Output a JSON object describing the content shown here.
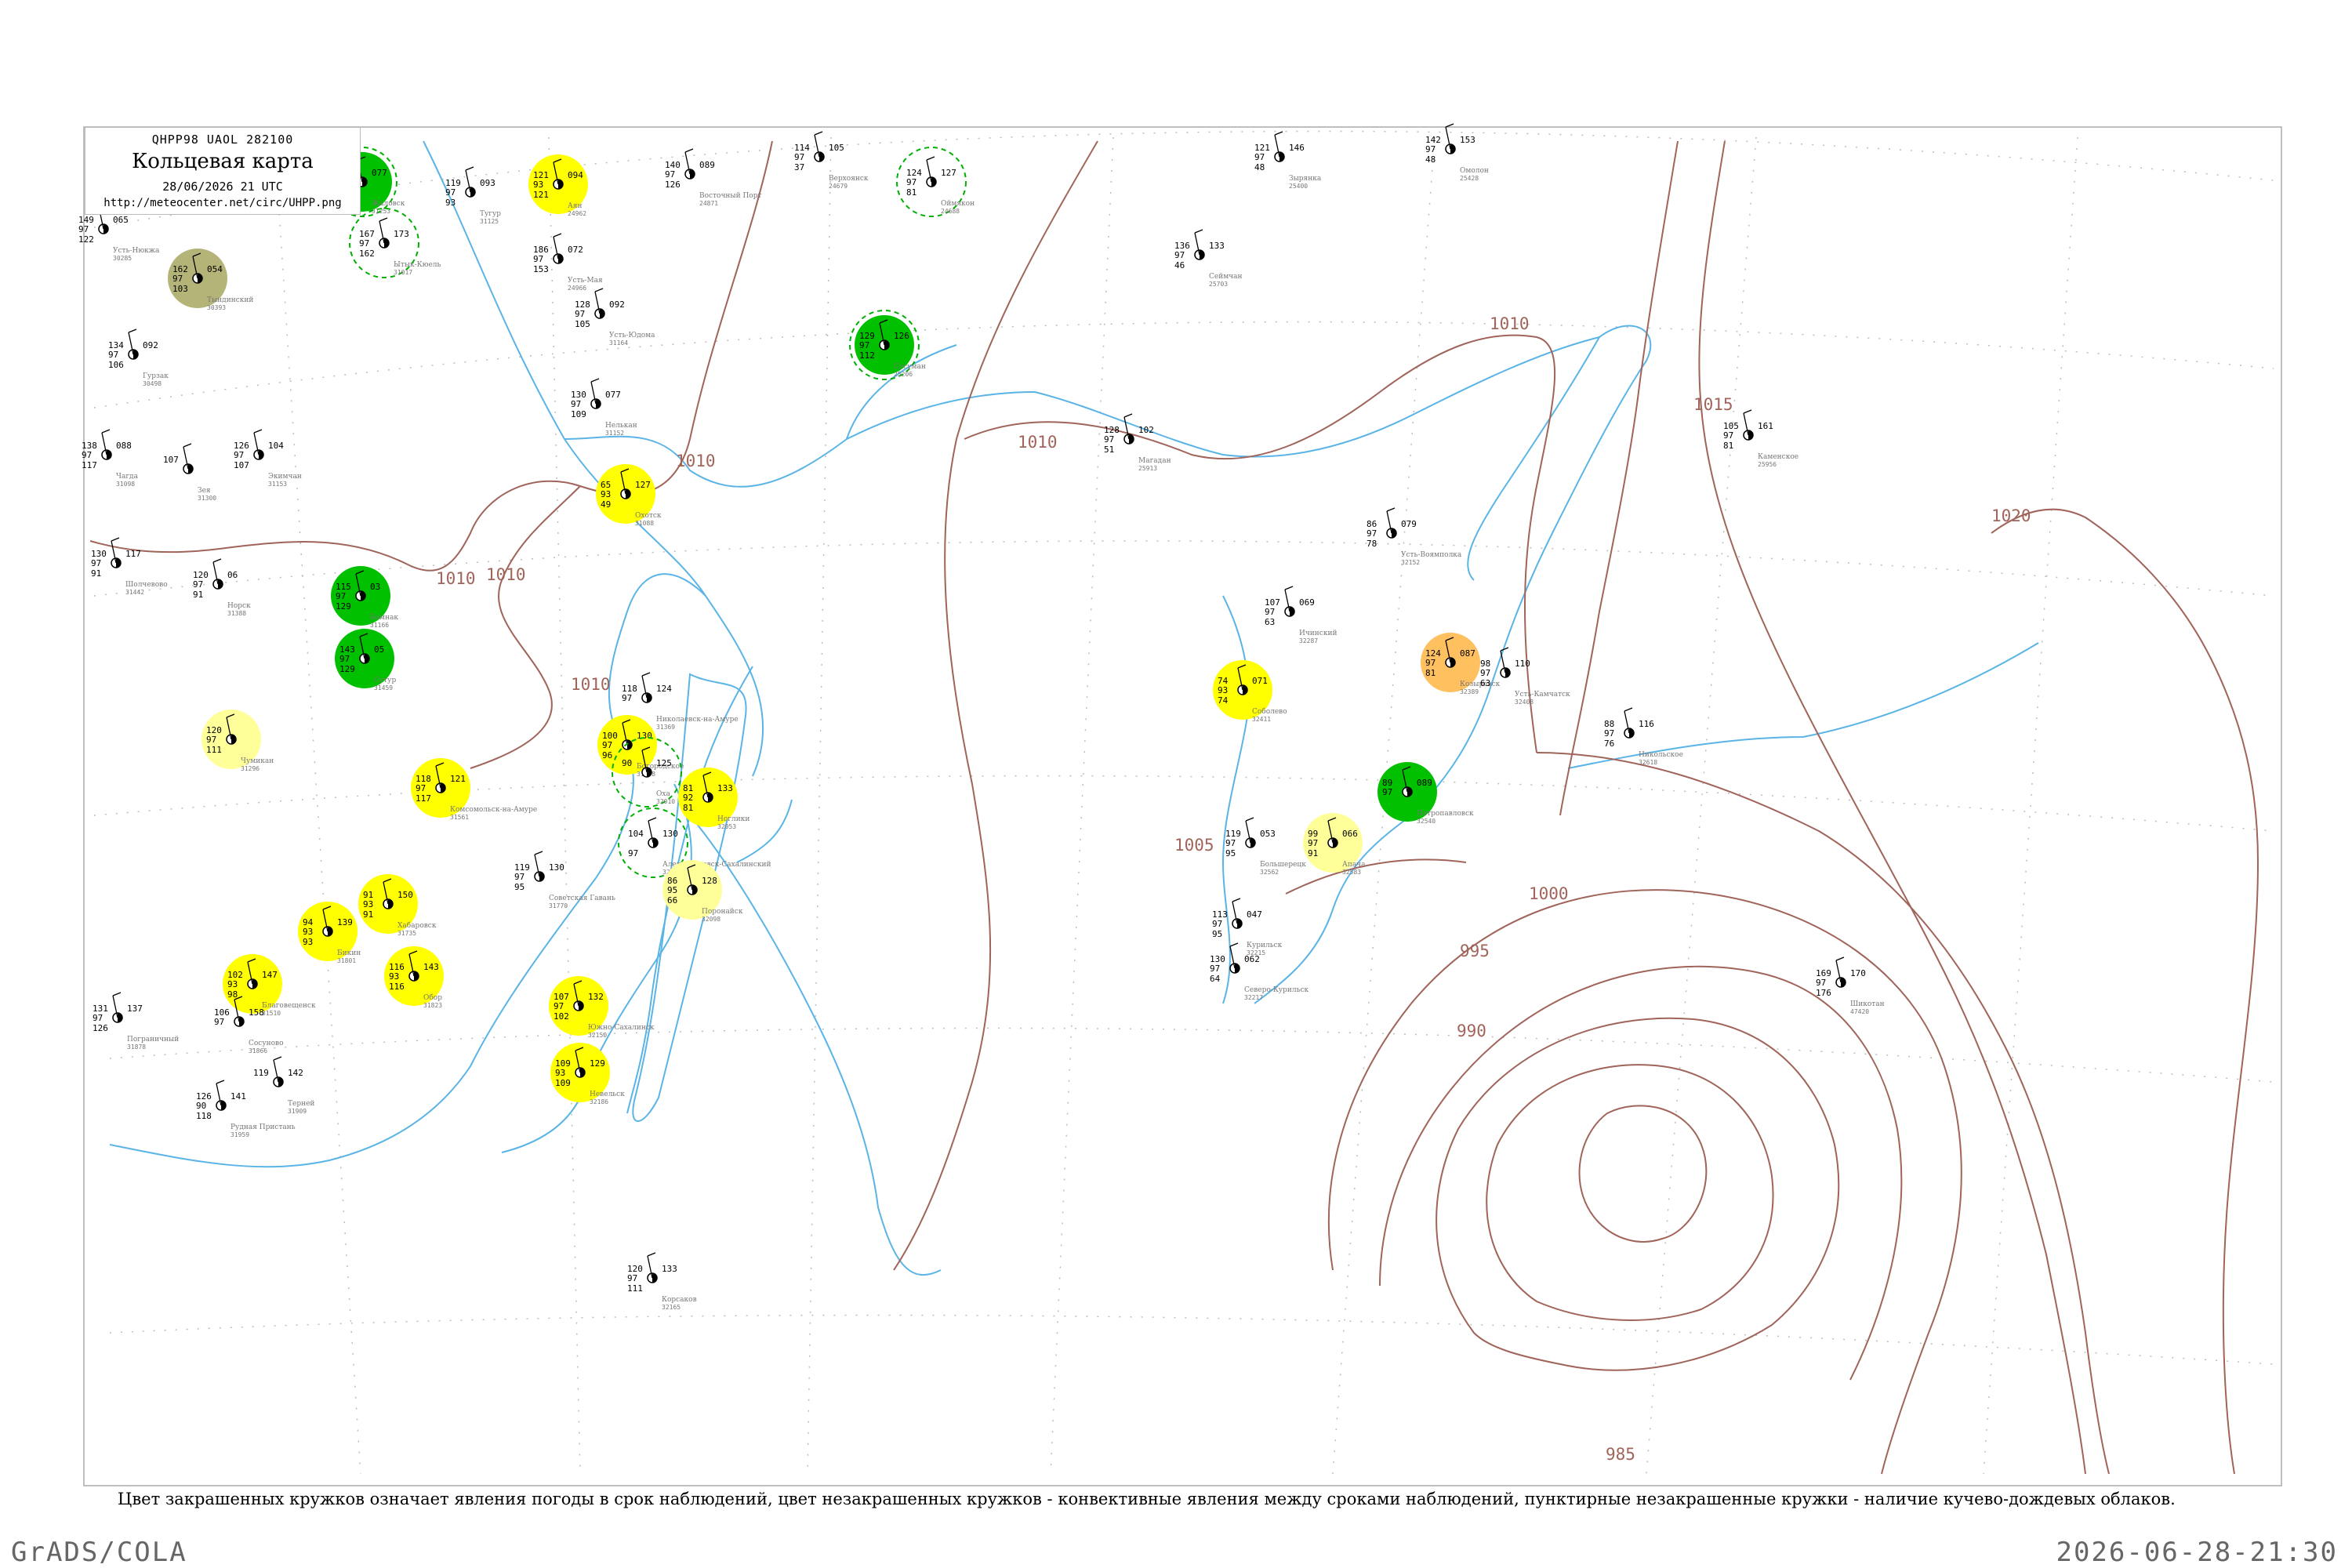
{
  "header": {
    "bulletin": "QHPP98  UAOL  282100",
    "title": "Кольцевая карта",
    "datetime": "28/06/2026 21 UTC",
    "url": "http://meteocenter.net/circ/UHPP.png"
  },
  "legend_note": "Цвет закрашенных кружков означает явления погоды в срок наблюдений, цвет незакрашенных кружков - конвективные явления между сроками наблюдений, пунктирные незакрашенные кружки - наличие кучево-дождевых облаков.",
  "footer": {
    "software": "GrADS/COLA",
    "timestamp": "2026-06-28-21:30"
  },
  "isobar_labels": [
    "1010",
    "1010",
    "1010",
    "1010",
    "1010",
    "1010",
    "1015",
    "1020",
    "1005",
    "1005",
    "1000",
    "995",
    "990",
    "985"
  ],
  "colors": {
    "isobar": "#a0645a",
    "coast": "#5ab4e6",
    "grid": "#bdbdbd",
    "yellow": "#ffff00",
    "light_yellow": "#ffff99",
    "green": "#00c000",
    "olive": "#b4b478",
    "orange": "#ffc060",
    "station": "#000000"
  },
  "stations": [
    {
      "name": "Усть-Нюкжа",
      "id": "30285",
      "temp": "149",
      "dew": "122",
      "p": "065",
      "mark": "97",
      "kind": "plain"
    },
    {
      "name": "Тындинский",
      "id": "30393",
      "temp": "162",
      "dew": "103",
      "p": "054",
      "mark": "97",
      "kind": "olive"
    },
    {
      "name": "Гурзак",
      "id": "30498",
      "temp": "134",
      "dew": "106",
      "p": "092",
      "mark": "97",
      "kind": "plain"
    },
    {
      "name": "Чагда",
      "id": "31098",
      "temp": "138",
      "dew": "117",
      "p": "088",
      "mark": "97",
      "kind": "plain"
    },
    {
      "name": "Зея",
      "id": "31300",
      "temp": "107",
      "dew": "",
      "p": "",
      "mark": "",
      "kind": "plain"
    },
    {
      "name": "Экимчан",
      "id": "31153",
      "temp": "126",
      "dew": "107",
      "p": "104",
      "mark": "97",
      "kind": "plain"
    },
    {
      "name": "Шолчевово",
      "id": "31442",
      "temp": "130",
      "dew": "91",
      "p": "117",
      "mark": "97",
      "kind": "plain"
    },
    {
      "name": "Норск",
      "id": "31388",
      "temp": "120",
      "dew": "91",
      "p": "06",
      "mark": "97",
      "kind": "plain"
    },
    {
      "name": "Бомнак",
      "id": "31166",
      "temp": "115",
      "dew": "129",
      "p": "03",
      "mark": "97",
      "kind": "green"
    },
    {
      "name": "Сутур",
      "id": "31459",
      "temp": "143",
      "dew": "129",
      "p": "05",
      "mark": "97",
      "kind": "green"
    },
    {
      "name": "Жаловск",
      "id": "31253",
      "temp": "158",
      "dew": "145",
      "p": "077",
      "mark": "97",
      "kind": "green_dash"
    },
    {
      "name": "Ытык-Кюель",
      "id": "31017",
      "temp": "167",
      "dew": "162",
      "p": "173",
      "mark": "97",
      "kind": "dash"
    },
    {
      "name": "Тугур",
      "id": "31125",
      "temp": "119",
      "dew": "93",
      "p": "093",
      "mark": "97",
      "kind": "plain"
    },
    {
      "name": "Аян",
      "id": "24962",
      "temp": "121",
      "dew": "121",
      "p": "094",
      "mark": "93",
      "kind": "yellow"
    },
    {
      "name": "Усть-Мая",
      "id": "24966",
      "temp": "186",
      "dew": "153",
      "p": "072",
      "mark": "97",
      "kind": "plain"
    },
    {
      "name": "Усть-Юдома",
      "id": "31164",
      "temp": "128",
      "dew": "105",
      "p": "092",
      "mark": "97",
      "kind": "plain"
    },
    {
      "name": "Нелькан",
      "id": "31152",
      "temp": "130",
      "dew": "109",
      "p": "077",
      "mark": "97",
      "kind": "plain"
    },
    {
      "name": "Охотск",
      "id": "31088",
      "temp": "65",
      "dew": "49",
      "p": "127",
      "mark": "93",
      "kind": "yellow"
    },
    {
      "name": "Восточный Порт",
      "id": "24871",
      "temp": "140",
      "dew": "126",
      "p": "089",
      "mark": "97",
      "kind": "plain"
    },
    {
      "name": "Верхоянск",
      "id": "24679",
      "temp": "114",
      "dew": "37",
      "p": "105",
      "mark": "97",
      "kind": "plain"
    },
    {
      "name": "Оймякон",
      "id": "24688",
      "temp": "124",
      "dew": "81",
      "p": "127",
      "mark": "97",
      "kind": "dash"
    },
    {
      "name": "Сусуман",
      "id": "25206",
      "temp": "129",
      "dew": "112",
      "p": "126",
      "mark": "97",
      "kind": "green_dash"
    },
    {
      "name": "Магадан",
      "id": "25913",
      "temp": "128",
      "dew": "51",
      "p": "102",
      "mark": "97",
      "kind": "plain"
    },
    {
      "name": "Зырянка",
      "id": "25400",
      "temp": "121",
      "dew": "48",
      "p": "146",
      "mark": "97",
      "kind": "plain"
    },
    {
      "name": "Сеймчан",
      "id": "25703",
      "temp": "136",
      "dew": "46",
      "p": "133",
      "mark": "97",
      "kind": "plain"
    },
    {
      "name": "Омолон",
      "id": "25428",
      "temp": "142",
      "dew": "48",
      "p": "153",
      "mark": "97",
      "kind": "plain"
    },
    {
      "name": "Каменское",
      "id": "25956",
      "temp": "105",
      "dew": "81",
      "p": "161",
      "mark": "97",
      "kind": "plain"
    },
    {
      "name": "Усть-Воямполка",
      "id": "32152",
      "temp": "86",
      "dew": "78",
      "p": "079",
      "mark": "97",
      "kind": "plain"
    },
    {
      "name": "Ичинский",
      "id": "32287",
      "temp": "107",
      "dew": "63",
      "p": "069",
      "mark": "97",
      "kind": "plain"
    },
    {
      "name": "Соболево",
      "id": "32411",
      "temp": "74",
      "dew": "74",
      "p": "071",
      "mark": "93",
      "kind": "yellow"
    },
    {
      "name": "Козыревск",
      "id": "32389",
      "temp": "124",
      "dew": "81",
      "p": "087",
      "mark": "97",
      "kind": "orange"
    },
    {
      "name": "Усть-Камчатск",
      "id": "32408",
      "temp": "98",
      "dew": "63",
      "p": "110",
      "mark": "97",
      "kind": "plain"
    },
    {
      "name": "Никольское",
      "id": "32618",
      "temp": "88",
      "dew": "76",
      "p": "116",
      "mark": "97",
      "kind": "plain"
    },
    {
      "name": "Петропавловск",
      "id": "32540",
      "temp": "89",
      "dew": "",
      "p": "089",
      "mark": "97",
      "kind": "green"
    },
    {
      "name": "Апача",
      "id": "32583",
      "temp": "99",
      "dew": "91",
      "p": "066",
      "mark": "97",
      "kind": "light_yellow"
    },
    {
      "name": "Большерецк",
      "id": "32562",
      "temp": "119",
      "dew": "95",
      "p": "053",
      "mark": "97",
      "kind": "plain"
    },
    {
      "name": "Курильск",
      "id": "32215",
      "temp": "113",
      "dew": "95",
      "p": "047",
      "mark": "97",
      "kind": "plain"
    },
    {
      "name": "Северо-Курильск",
      "id": "32217",
      "temp": "130",
      "dew": "64",
      "p": "062",
      "mark": "97",
      "kind": "plain"
    },
    {
      "name": "Шикотан",
      "id": "47420",
      "temp": "169",
      "dew": "176",
      "p": "170",
      "mark": "97",
      "kind": "plain"
    },
    {
      "name": "Николаевск-на-Амуре",
      "id": "31369",
      "temp": "118",
      "dew": "",
      "p": "124",
      "mark": "97",
      "kind": "plain"
    },
    {
      "name": "Богородское",
      "id": "31478",
      "temp": "100",
      "dew": "96",
      "p": "130",
      "mark": "97",
      "kind": "yellow"
    },
    {
      "name": "Оха",
      "id": "32010",
      "temp": "90",
      "dew": "",
      "p": "125",
      "mark": "",
      "kind": "dash"
    },
    {
      "name": "Ноглики",
      "id": "32053",
      "temp": "81",
      "dew": "81",
      "p": "133",
      "mark": "92",
      "kind": "yellow"
    },
    {
      "name": "Александровск-Сахалинский",
      "id": "32061",
      "temp": "104",
      "dew": "97",
      "p": "130",
      "mark": "",
      "kind": "dash"
    },
    {
      "name": "Поронайск",
      "id": "32098",
      "temp": "86",
      "dew": "66",
      "p": "128",
      "mark": "95",
      "kind": "light_yellow"
    },
    {
      "name": "Комсомольск-на-Амуре",
      "id": "31561",
      "temp": "118",
      "dew": "117",
      "p": "121",
      "mark": "97",
      "kind": "yellow"
    },
    {
      "name": "Чумикан",
      "id": "31296",
      "temp": "120",
      "dew": "111",
      "p": "",
      "mark": "97",
      "kind": "light_yellow"
    },
    {
      "name": "Хабаровск",
      "id": "31735",
      "temp": "91",
      "dew": "91",
      "p": "150",
      "mark": "93",
      "kind": "yellow"
    },
    {
      "name": "Бикин",
      "id": "31801",
      "temp": "94",
      "dew": "93",
      "p": "139",
      "mark": "93",
      "kind": "yellow"
    },
    {
      "name": "Благовещенск",
      "id": "31510",
      "temp": "102",
      "dew": "98",
      "p": "147",
      "mark": "93",
      "kind": "yellow"
    },
    {
      "name": "Обор",
      "id": "31823",
      "temp": "116",
      "dew": "116",
      "p": "143",
      "mark": "93",
      "kind": "yellow"
    },
    {
      "name": "Южно-Сахалинск",
      "id": "32150",
      "temp": "107",
      "dew": "102",
      "p": "132",
      "mark": "97",
      "kind": "yellow"
    },
    {
      "name": "Невельск",
      "id": "32186",
      "temp": "109",
      "dew": "109",
      "p": "129",
      "mark": "93",
      "kind": "yellow"
    },
    {
      "name": "Советская Гавань",
      "id": "31770",
      "temp": "119",
      "dew": "95",
      "p": "130",
      "mark": "97",
      "kind": "plain"
    },
    {
      "name": "Сосуново",
      "id": "31866",
      "temp": "106",
      "dew": "",
      "p": "158",
      "mark": "97",
      "kind": "plain"
    },
    {
      "name": "Рудная Пристань",
      "id": "31959",
      "temp": "126",
      "dew": "118",
      "p": "141",
      "mark": "90",
      "kind": "plain"
    },
    {
      "name": "Терней",
      "id": "31909",
      "temp": "119",
      "dew": "",
      "p": "142",
      "mark": "",
      "kind": "plain"
    },
    {
      "name": "Корсаков",
      "id": "32165",
      "temp": "120",
      "dew": "111",
      "p": "133",
      "mark": "97",
      "kind": "plain"
    },
    {
      "name": "Пограничный",
      "id": "31878",
      "temp": "131",
      "dew": "126",
      "p": "137",
      "mark": "97",
      "kind": "plain"
    }
  ]
}
